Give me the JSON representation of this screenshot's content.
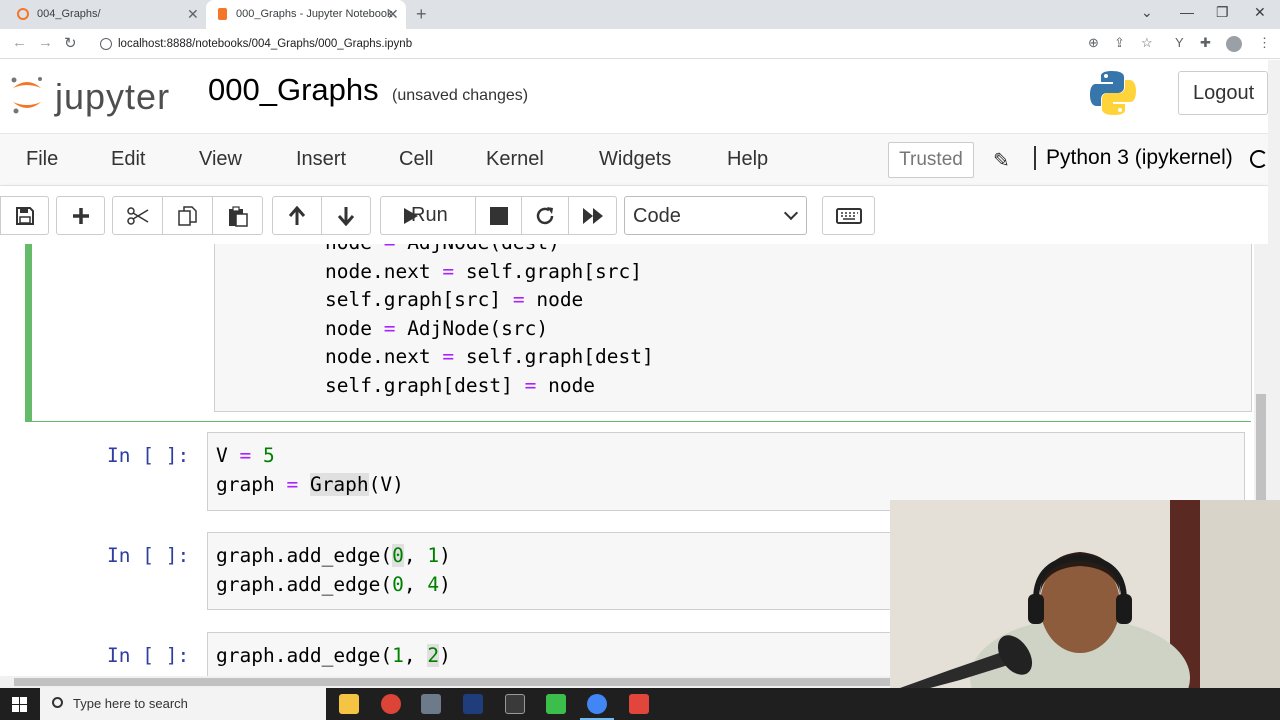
{
  "browser": {
    "tabs": [
      {
        "label": "004_Graphs/"
      },
      {
        "label": "000_Graphs - Jupyter Notebook"
      }
    ],
    "new_tab_symbol": "+",
    "url": "localhost:8888/notebooks/004_Graphs/000_Graphs.ipynb"
  },
  "header": {
    "logo_text": "jupyter",
    "notebook_title": "000_Graphs",
    "save_status": "(unsaved changes)",
    "logout_label": "Logout"
  },
  "menubar": {
    "items": [
      "File",
      "Edit",
      "View",
      "Insert",
      "Cell",
      "Kernel",
      "Widgets",
      "Help"
    ],
    "trusted_label": "Trusted",
    "kernel_name": "Python 3 (ipykernel)"
  },
  "toolbar": {
    "run_label": "Run",
    "cell_type": "Code"
  },
  "cells": {
    "prompt": "In [ ]:",
    "cell1_lines": [
      "node = AdjNode(dest)",
      "node.next = self.graph[src]",
      "self.graph[src] = node",
      "node = AdjNode(src)",
      "node.next = self.graph[dest]",
      "self.graph[dest] = node"
    ],
    "cell2_lines": [
      "V = 5",
      "graph = Graph(V)"
    ],
    "cell3_lines": [
      "graph.add_edge(0, 1)",
      "graph.add_edge(0, 4)"
    ],
    "cell4_lines": [
      "graph.add_edge(1, 2)"
    ]
  },
  "taskbar": {
    "search_placeholder": "Type here to search"
  },
  "colors": {
    "jupyter_orange": "#f37726",
    "selected_cell_border": "#66bb6a",
    "prompt_blue": "#303f9f",
    "keyword_purple": "#aa22ff",
    "number_green": "#008000"
  }
}
